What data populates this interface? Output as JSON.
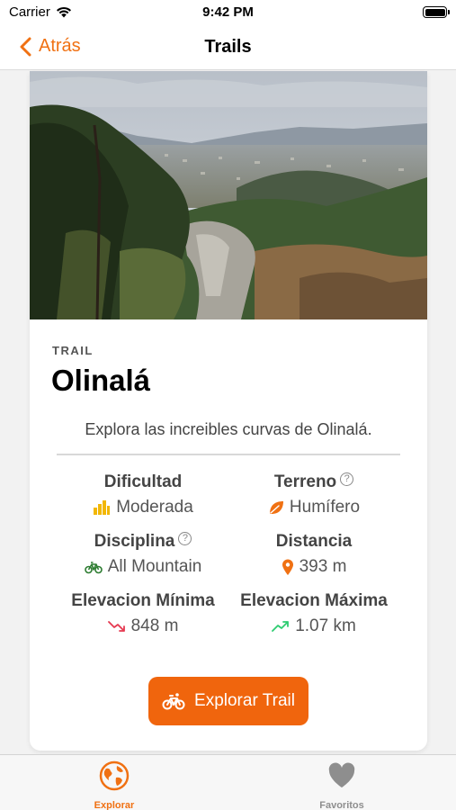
{
  "status_bar": {
    "carrier": "Carrier",
    "time": "9:42 PM"
  },
  "nav": {
    "back_label": "Atrás",
    "title": "Trails"
  },
  "trail": {
    "section_label": "TRAIL",
    "name": "Olinalá",
    "description": "Explora las increibles curvas de Olinalá."
  },
  "stats": {
    "difficulty": {
      "title": "Dificultad",
      "value": "Moderada",
      "icon": "bar-chart-icon"
    },
    "terrain": {
      "title": "Terreno",
      "value": "Humífero",
      "icon": "leaf-icon"
    },
    "discipline": {
      "title": "Disciplina",
      "value": "All Mountain",
      "icon": "bicycle-icon"
    },
    "distance": {
      "title": "Distancia",
      "value": "393 m",
      "icon": "location-pin-icon"
    },
    "min_elevation": {
      "title": "Elevacion Mínima",
      "value": "848 m",
      "icon": "trend-down-icon"
    },
    "max_elevation": {
      "title": "Elevacion Máxima",
      "value": "1.07 km",
      "icon": "trend-up-icon"
    }
  },
  "explore_button": {
    "label": "Explorar Trail"
  },
  "tabs": [
    {
      "label": "Explorar",
      "icon": "globe-icon",
      "active": true
    },
    {
      "label": "Favoritos",
      "icon": "heart-icon",
      "active": false
    }
  ],
  "colors": {
    "accent": "#f07113",
    "button": "#f0650d",
    "difficulty_icon": "#f2b705",
    "discipline_icon": "#2e7d32",
    "trend_down": "#e53950",
    "trend_up": "#2ecc71",
    "tab_inactive": "#8e8e8e"
  }
}
